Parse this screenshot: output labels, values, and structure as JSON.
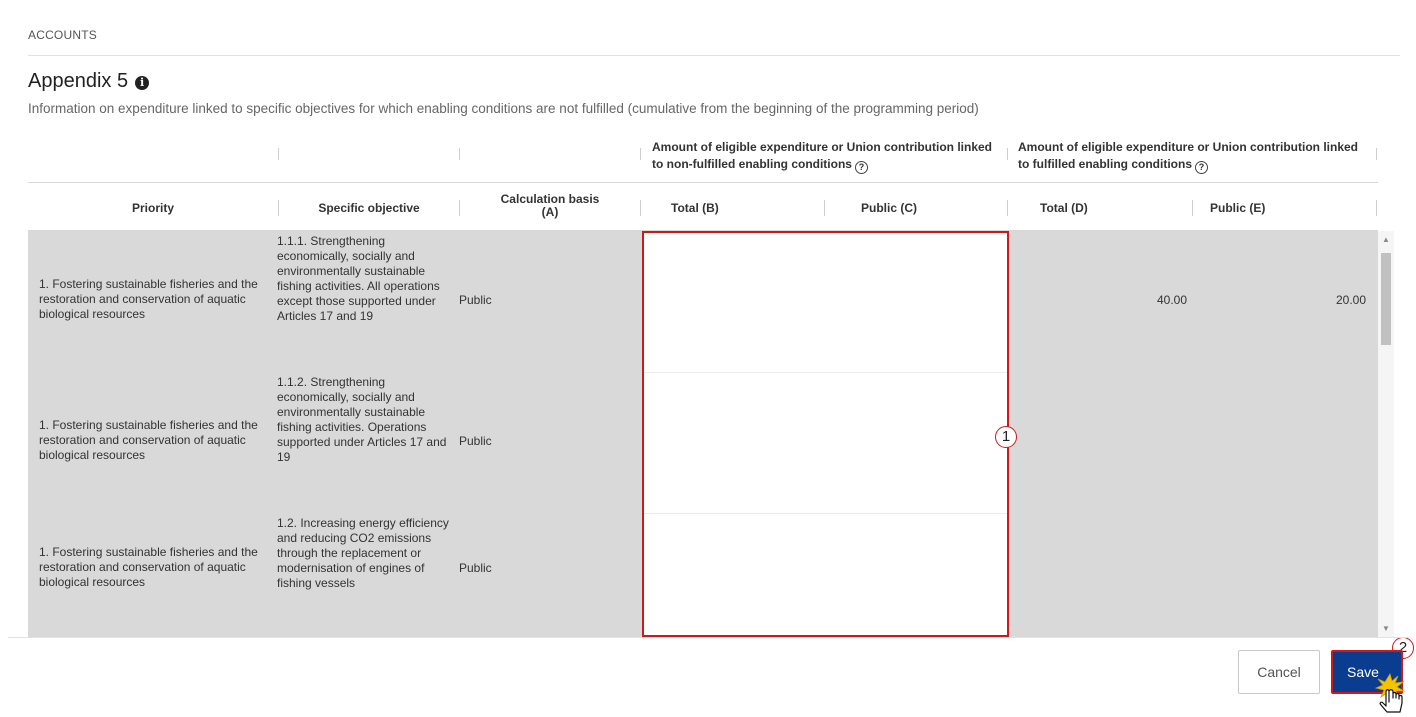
{
  "breadcrumb": "ACCOUNTS",
  "title": "Appendix 5",
  "title_icon": "info-icon",
  "subtitle": "Information on expenditure linked to specific objectives for which enabling conditions are not fulfilled (cumulative from the beginning of the programming period)",
  "table": {
    "group_headers": {
      "non_fulfilled": "Amount of eligible expenditure or Union contribution linked to non-fulfilled enabling conditions",
      "fulfilled": "Amount of eligible expenditure or Union contribution linked to fulfilled enabling conditions"
    },
    "columns": {
      "priority": "Priority",
      "specific_objective": "Specific objective",
      "calculation_basis_line1": "Calculation basis",
      "calculation_basis_line2": "(A)",
      "total_b": "Total  (B)",
      "public_c": "Public  (C)",
      "total_d": "Total  (D)",
      "public_e": "Public  (E)"
    },
    "rows": [
      {
        "priority": "1. Fostering sustainable fisheries and the restoration and conservation of aquatic biological resources",
        "specific_objective": "1.1.1. Strengthening economically, socially and environmentally sustainable fishing activities. All operations except those supported under Articles 17 and 19",
        "calculation_basis": "Public",
        "total_b": "",
        "public_c": "",
        "total_d": "40.00",
        "public_e": "20.00"
      },
      {
        "priority": "1. Fostering sustainable fisheries and the restoration and conservation of aquatic biological resources",
        "specific_objective": "1.1.2. Strengthening economically, socially and environmentally sustainable fishing activities. Operations supported under Articles 17 and 19",
        "calculation_basis": "Public",
        "total_b": "",
        "public_c": "",
        "total_d": "",
        "public_e": ""
      },
      {
        "priority": "1. Fostering sustainable fisheries and the restoration and conservation of aquatic biological resources",
        "specific_objective": "1.2. Increasing energy efficiency and reducing CO2 emissions through the replacement or modernisation of engines of fishing vessels",
        "calculation_basis": "Public",
        "total_b": "",
        "public_c": "",
        "total_d": "",
        "public_e": ""
      }
    ]
  },
  "callouts": {
    "one": "1",
    "two": "2"
  },
  "buttons": {
    "cancel": "Cancel",
    "save": "Save"
  },
  "colors": {
    "primary": "#0a3d8f",
    "highlight": "#cc1a1a",
    "row_bg": "#d9d9d9"
  }
}
